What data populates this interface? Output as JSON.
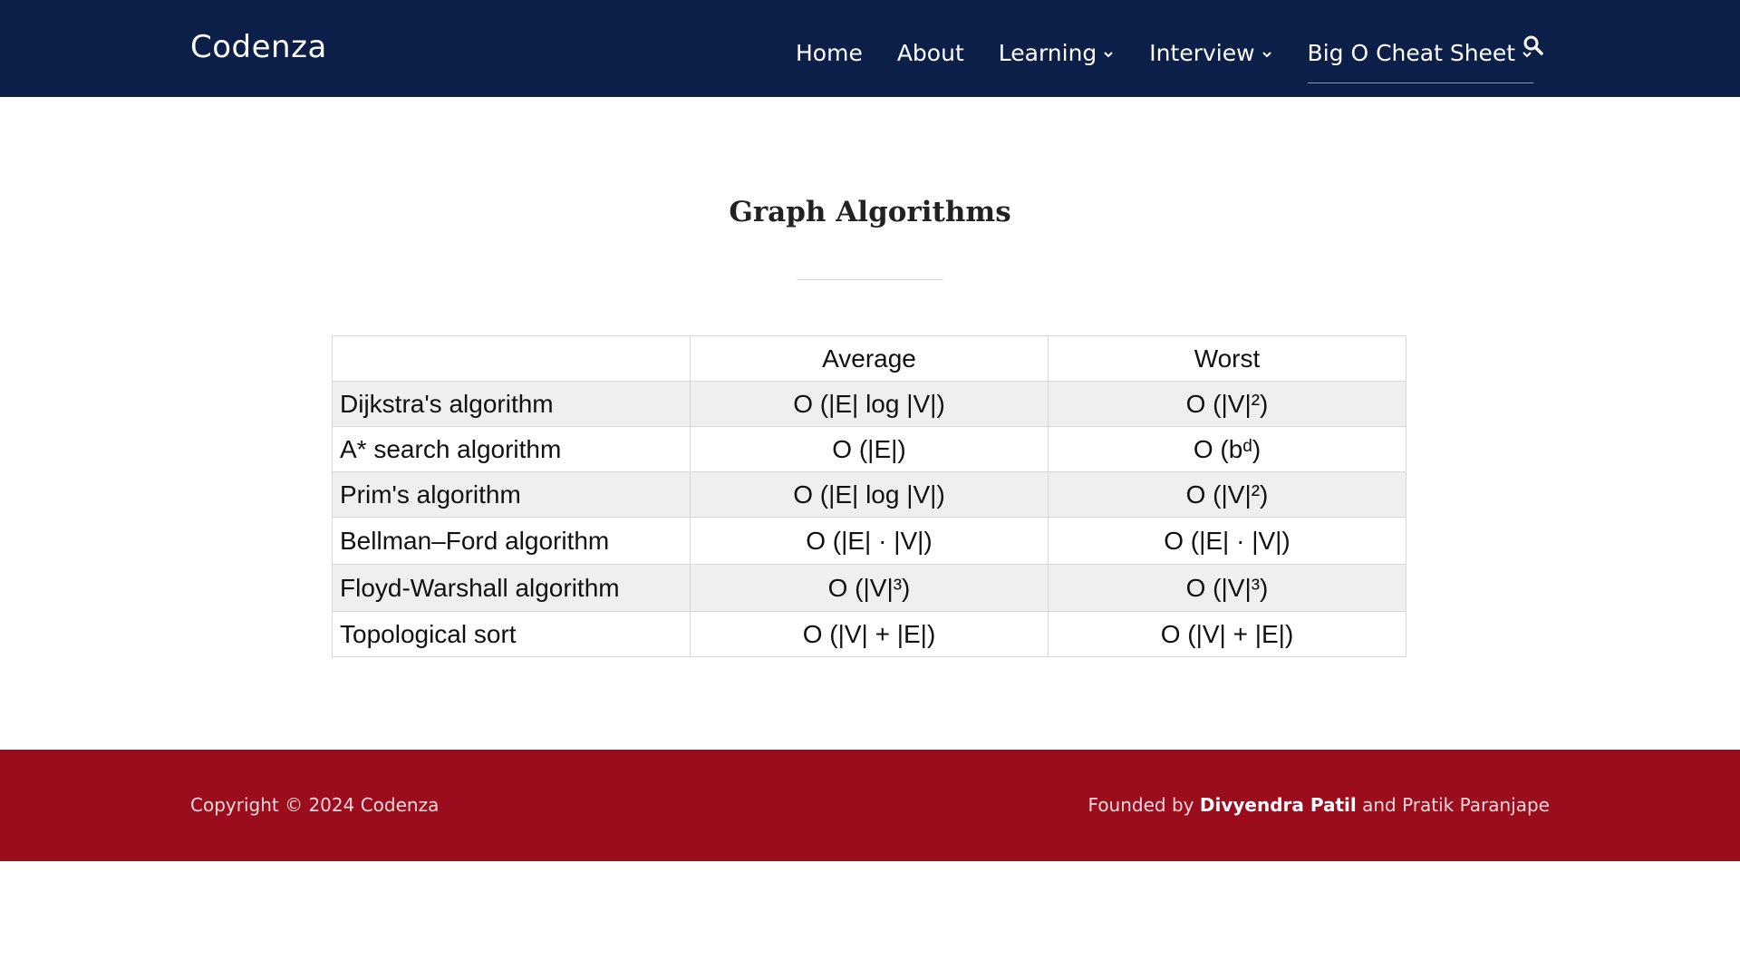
{
  "header": {
    "brand": "Codenza",
    "nav": [
      {
        "label": "Home",
        "dropdown": false
      },
      {
        "label": "About",
        "dropdown": false
      },
      {
        "label": "Learning",
        "dropdown": true
      },
      {
        "label": "Interview",
        "dropdown": true
      },
      {
        "label": "Big O Cheat Sheet",
        "dropdown": true,
        "active": true
      }
    ],
    "search_icon": "search-icon"
  },
  "main": {
    "title": "Graph Algorithms",
    "table": {
      "columns": [
        "",
        "Average",
        "Worst"
      ],
      "rows": [
        [
          "Dijkstra's algorithm",
          "O (|E| log |V|)",
          "O (|V|²)"
        ],
        [
          "A* search algorithm",
          "O (|E|)",
          "O (bᵈ)"
        ],
        [
          "Prim's algorithm",
          "O (|E| log |V|)",
          "O (|V|²)"
        ],
        [
          "Bellman–Ford algorithm",
          "O (|E| · |V|)",
          "O (|E| · |V|)"
        ],
        [
          "Floyd-Warshall algorithm",
          "O (|V|³)",
          "O (|V|³)"
        ],
        [
          "Topological sort",
          "O (|V| + |E|)",
          "O (|V| + |E|)"
        ]
      ]
    }
  },
  "footer": {
    "copyright": "Copyright © 2024 Codenza",
    "founded_prefix": "Founded by ",
    "founder1": "Divyendra Patil",
    "founded_mid": " and ",
    "founder2": "Pratik Paranjape"
  },
  "colors": {
    "header_bg": "#0b1f49",
    "footer_bg": "#9b0c1c",
    "row_alt": "#efefef"
  }
}
